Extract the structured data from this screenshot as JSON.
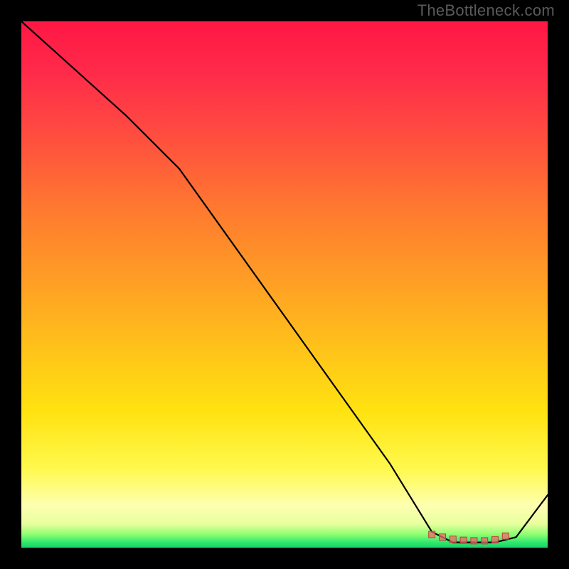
{
  "watermark": "TheBottleneck.com",
  "colors": {
    "line": "#000000",
    "marker_fill": "#ef6a6a",
    "marker_stroke": "#c43d3d",
    "background_black": "#000000"
  },
  "chart_data": {
    "type": "line",
    "title": "",
    "xlabel": "",
    "ylabel": "",
    "xlim": [
      0,
      100
    ],
    "ylim": [
      0,
      100
    ],
    "series": [
      {
        "name": "curve",
        "x": [
          0,
          10,
          20,
          30,
          40,
          50,
          60,
          70,
          78,
          82,
          86,
          90,
          94,
          100
        ],
        "y": [
          100,
          91,
          82,
          72,
          58,
          44,
          30,
          16,
          3,
          1,
          1,
          1,
          2,
          10
        ]
      }
    ],
    "markers": {
      "name": "optimum-band",
      "x": [
        78,
        80,
        82,
        84,
        86,
        88,
        90,
        92
      ],
      "y": [
        2.5,
        2.0,
        1.6,
        1.4,
        1.3,
        1.3,
        1.5,
        2.2
      ]
    }
  }
}
